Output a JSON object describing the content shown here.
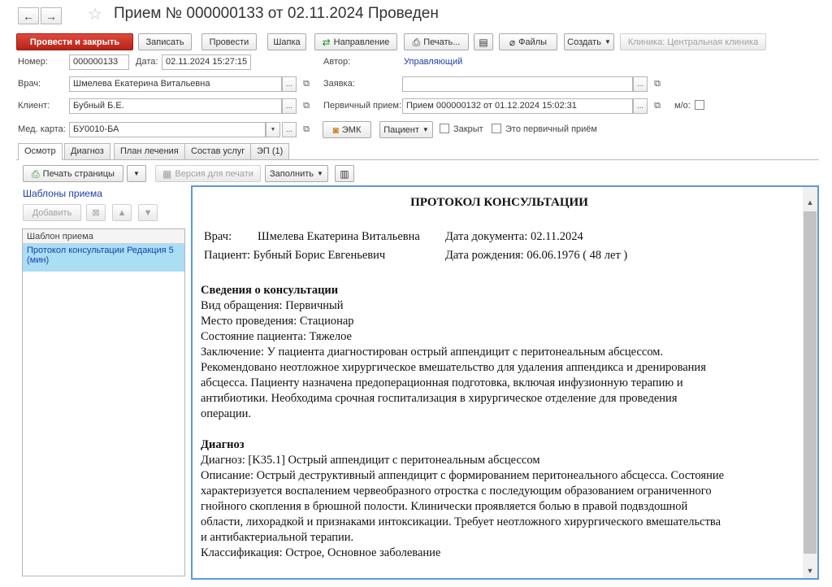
{
  "window": {
    "title": "Прием № 000000133 от 02.11.2024 Проведен",
    "back_glyph": "←",
    "forward_glyph": "→",
    "star_glyph": "☆"
  },
  "toolbar": {
    "post_close": "Провести и закрыть",
    "save": "Записать",
    "post": "Провести",
    "header": "Шапка",
    "direction": "Направление",
    "print": "Печать...",
    "files": "Файлы",
    "create": "Создать",
    "clinic": "Клиника: Центральная клиника"
  },
  "form": {
    "number_label": "Номер:",
    "number_value": "000000133",
    "date_label": "Дата:",
    "date_value": "02.11.2024 15:27:15",
    "author_label": "Автор:",
    "author_value": "Управляющий",
    "doctor_label": "Врач:",
    "doctor_value": "Шмелева Екатерина Витальевна",
    "request_label": "Заявка:",
    "request_value": "",
    "client_label": "Клиент:",
    "client_value": "Бубный Б.Е.",
    "primary_label": "Первичный прием:",
    "primary_value": "Прием 000000132 от 01.12.2024 15:02:31",
    "mo_label": "м/о:",
    "card_label": "Мед. карта:",
    "card_value": "БУ0010-БА",
    "emk_button": "ЭМК",
    "patient_button": "Пациент",
    "closed_label": "Закрыт",
    "is_primary_label": "Это первичный приём",
    "ellipsis": "...",
    "open_glyph": "⧉"
  },
  "tabs": [
    {
      "label": "Осмотр"
    },
    {
      "label": "Диагноз"
    },
    {
      "label": "План лечения"
    },
    {
      "label": "Состав услуг"
    },
    {
      "label": "ЭП (1)"
    }
  ],
  "subtoolbar": {
    "print_pages": "Печать страницы",
    "print_version": "Версия для печати",
    "fill": "Заполнить"
  },
  "templates": {
    "title": "Шаблоны приема",
    "add_button": "Добавить",
    "column": "Шаблон приема",
    "rows": [
      {
        "label": "Протокол консультации Редакция 5 (мин)"
      }
    ]
  },
  "protocol": {
    "title": "ПРОТОКОЛ КОНСУЛЬТАЦИИ",
    "doctor_label": "Врач:",
    "doctor_value": "Шмелева Екатерина Витальевна",
    "doc_date": "Дата документа: 02.11.2024",
    "patient": "Пациент: Бубный Борис Евгеньевич",
    "birth_date": "Дата рождения:  06.06.1976 ( 48 лет )",
    "section1_title": "Сведения о консультации",
    "visit_type": "Вид обращения: Первичный",
    "place": "Место проведения: Стационар",
    "state": "Состояние пациента: Тяжелое",
    "conclusion_lines": [
      "Заключение: У пациента диагностирован острый аппендицит с перитонеальным абсцессом.",
      "Рекомендовано неотложное хирургическое вмешательство для удаления аппендикса и дренирования",
      "абсцесса. Пациенту назначена предоперационная подготовка, включая инфузионную терапию и",
      "антибиотики. Необходима срочная госпитализация в хирургическое отделение для проведения",
      "операции."
    ],
    "section2_title": "Диагноз",
    "diagnosis": "Диагноз: [K35.1] Острый аппендицит с перитонеальным абсцессом",
    "description_lines": [
      "Описание: Острый деструктивный аппендицит с формированием перитонеального абсцесса. Состояние",
      "характеризуется воспалением червеобразного отростка с последующим образованием ограниченного",
      "гнойного скопления в брюшной полости. Клинически проявляется болью в правой подвздошной",
      "области, лихорадкой и признаками интоксикации. Требует неотложного хирургического вмешательства",
      "и антибактериальной терапии."
    ],
    "classification": "Классификация: Острое, Основное заболевание"
  },
  "colors": {
    "primary_button": "#c92d20",
    "link": "#1c3fa8",
    "selection": "#a9def4",
    "doc_border": "#5b9bd5"
  }
}
